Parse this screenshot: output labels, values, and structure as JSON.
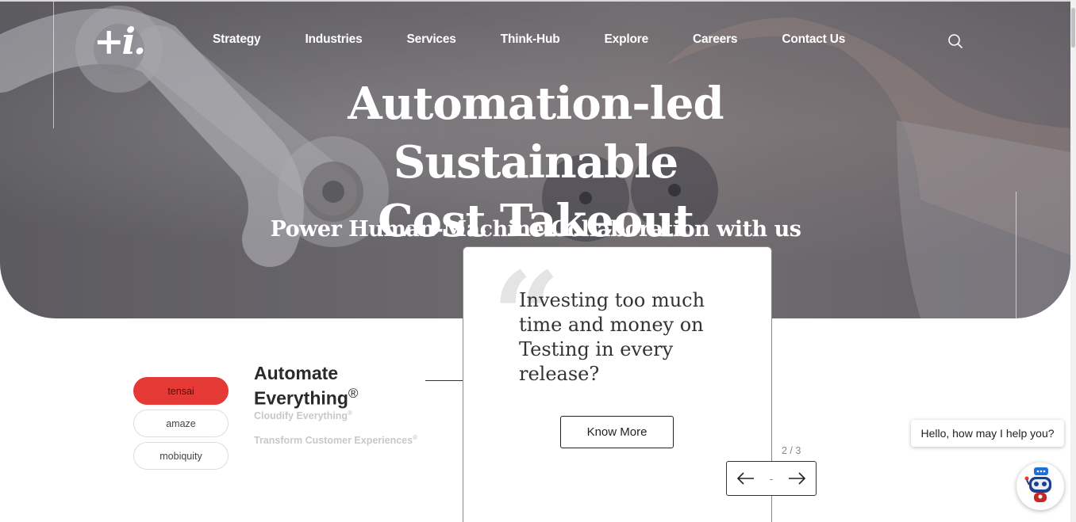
{
  "header": {
    "logo_text": "+i.",
    "nav": [
      {
        "label": "Strategy"
      },
      {
        "label": "Industries"
      },
      {
        "label": "Services"
      },
      {
        "label": "Think-Hub"
      },
      {
        "label": "Explore"
      },
      {
        "label": "Careers"
      },
      {
        "label": "Contact Us"
      }
    ]
  },
  "hero": {
    "title_line1": "Automation-led Sustainable",
    "title_line2": "Cost Takeout",
    "subtitle": "Power Human-Machine Collaboration with us"
  },
  "brands": [
    {
      "label": "tensai",
      "active": true
    },
    {
      "label": "amaze",
      "active": false
    },
    {
      "label": "mobiquity",
      "active": false
    }
  ],
  "tagline": {
    "main_line1": "Automate",
    "main_line2": "Everything",
    "registered": "®",
    "sub1": "Cloudify Everything",
    "sub2": "Transform Customer Experiences"
  },
  "card": {
    "quote_mark": "“",
    "text": "Investing too much time and money on Testing in every release?",
    "button": "Know More"
  },
  "carousel": {
    "counter": "2 / 3",
    "separator": "-"
  },
  "chat": {
    "bubble": "Hello, how may I help you?"
  },
  "colors": {
    "accent_red": "#e53935",
    "hero_white": "#ffffff"
  }
}
